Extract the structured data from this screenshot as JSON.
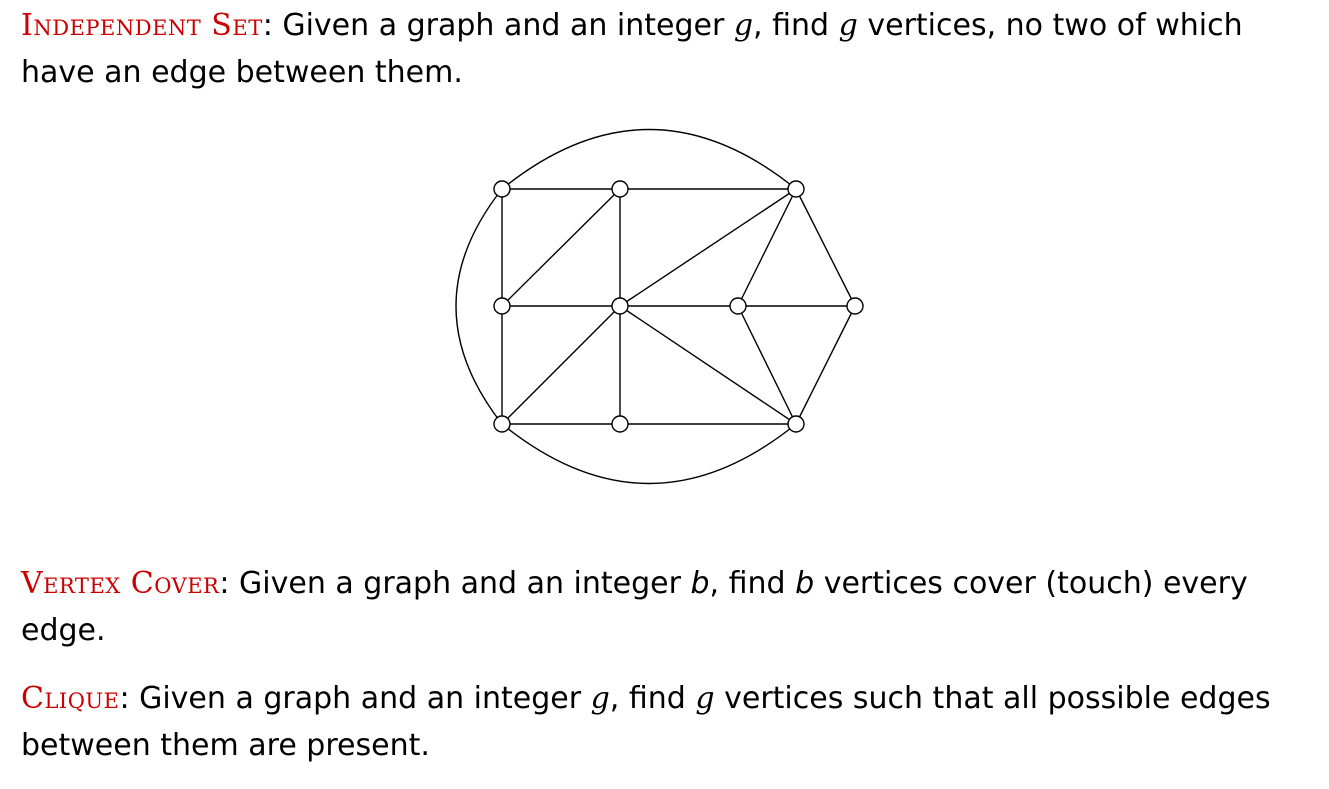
{
  "independent_set": {
    "term": "Independent Set",
    "colon": ":",
    "t1": " Given a graph and an integer ",
    "var1": "g",
    "t2": ", find ",
    "var2": "g",
    "t3": " vertices, no two of which have an edge between them."
  },
  "vertex_cover": {
    "term": "Vertex Cover",
    "colon": ":",
    "t1": " Given a graph and an integer ",
    "var1": "b",
    "t2": ", find ",
    "var2": "b",
    "t3": " vertices cover (touch) every edge."
  },
  "clique": {
    "term": "Clique",
    "colon": ":",
    "t1": " Given a graph and an integer ",
    "var1": "g",
    "t2": ", find ",
    "var2": "g",
    "t3": " vertices such that all possible edges between them are present."
  },
  "colors": {
    "term_red": "#cc0000",
    "text": "#000000",
    "vertex_fill": "#ffffff",
    "edge": "#000000"
  },
  "graph": {
    "vertices": [
      "TL",
      "TM",
      "TR",
      "ML",
      "C",
      "M2",
      "R",
      "BL",
      "BM",
      "BR"
    ],
    "edges": [
      [
        "TL",
        "TM"
      ],
      [
        "TM",
        "TR"
      ],
      [
        "TL",
        "ML"
      ],
      [
        "ML",
        "BL"
      ],
      [
        "TM",
        "C"
      ],
      [
        "C",
        "BM"
      ],
      [
        "TM",
        "ML"
      ],
      [
        "ML",
        "C"
      ],
      [
        "C",
        "M2"
      ],
      [
        "M2",
        "R"
      ],
      [
        "TR",
        "C"
      ],
      [
        "TR",
        "M2"
      ],
      [
        "TR",
        "R"
      ],
      [
        "C",
        "BL"
      ],
      [
        "C",
        "BR"
      ],
      [
        "M2",
        "BR"
      ],
      [
        "R",
        "BR"
      ],
      [
        "BL",
        "BM"
      ],
      [
        "BM",
        "BR"
      ]
    ],
    "arcs": [
      [
        "TL",
        "TR",
        "top"
      ],
      [
        "TL",
        "BL",
        "left"
      ],
      [
        "BL",
        "BR",
        "bottom"
      ]
    ]
  }
}
